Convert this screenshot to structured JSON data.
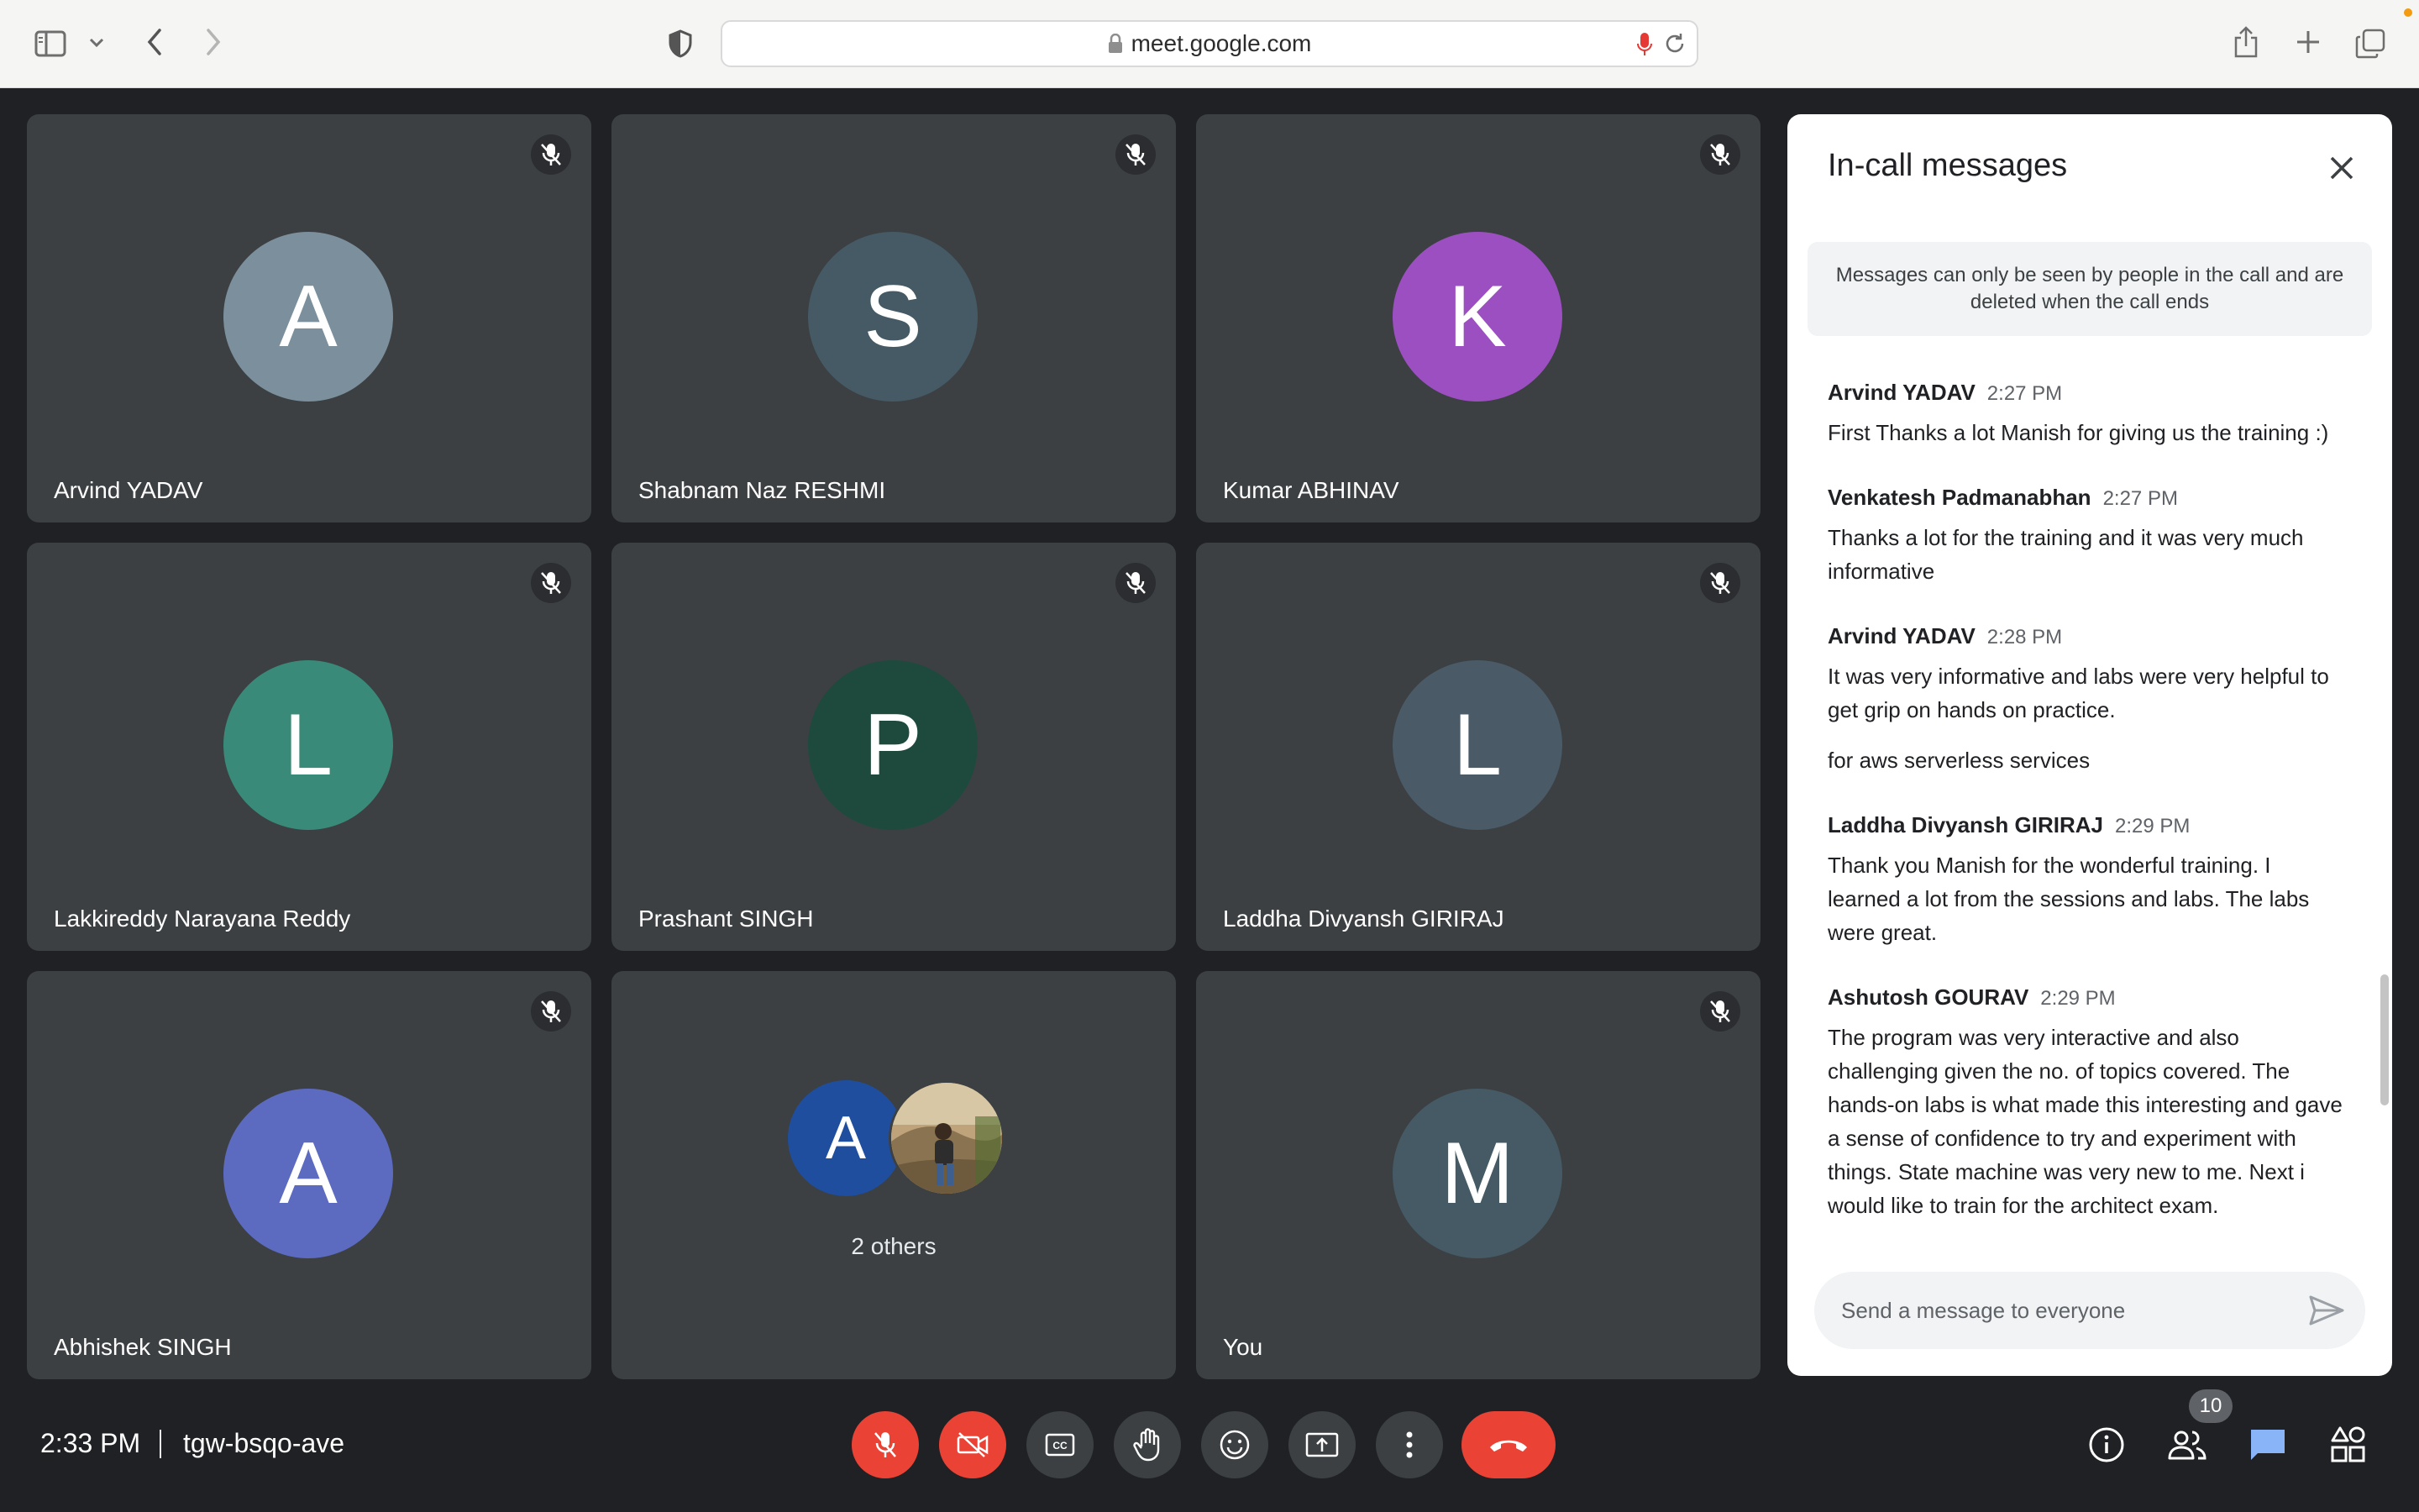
{
  "browser": {
    "url": "meet.google.com"
  },
  "tiles": [
    {
      "initial": "A",
      "name": "Arvind YADAV",
      "color": "#7b8f9c"
    },
    {
      "initial": "S",
      "name": "Shabnam Naz RESHMI",
      "color": "#455a64"
    },
    {
      "initial": "K",
      "name": "Kumar ABHINAV",
      "color": "#9c4fc0"
    },
    {
      "initial": "L",
      "name": "Lakkireddy Narayana Reddy",
      "color": "#3a8a7a"
    },
    {
      "initial": "P",
      "name": "Prashant SINGH",
      "color": "#1e4a3d"
    },
    {
      "initial": "L",
      "name": "Laddha Divyansh GIRIRAJ",
      "color": "#4a5a66"
    },
    {
      "initial": "A",
      "name": "Abhishek SINGH",
      "color": "#5c6bc0"
    },
    {
      "initial": "A",
      "label": "2 others",
      "color": "#1f4e9e"
    },
    {
      "initial": "M",
      "name": "You",
      "color": "#455a64"
    }
  ],
  "chat": {
    "title": "In-call messages",
    "notice": "Messages can only be seen by people in the call and are deleted when the call ends",
    "messages": [
      {
        "sender": "Arvind YADAV",
        "time": "2:27 PM",
        "text": "First Thanks a lot Manish for giving us the training :)"
      },
      {
        "sender": "Venkatesh Padmanabhan",
        "time": "2:27 PM",
        "text": "Thanks a lot for the training and it was very much informative"
      },
      {
        "sender": "Arvind YADAV",
        "time": "2:28 PM",
        "text": "It was very informative and labs were very helpful to get grip on hands on practice.",
        "extra": "for aws serverless services"
      },
      {
        "sender": "Laddha Divyansh GIRIRAJ",
        "time": "2:29 PM",
        "text": "Thank you Manish for the wonderful training. I learned a lot from the sessions and labs. The labs were great."
      },
      {
        "sender": "Ashutosh GOURAV",
        "time": "2:29 PM",
        "text": "The program was very interactive and also challenging given the no. of topics covered. The hands-on labs is what made this interesting and gave a sense of confidence to try and experiment with things. State machine was very new to me. Next i would like to train for the architect exam."
      }
    ],
    "input_placeholder": "Send a message to everyone"
  },
  "bottombar": {
    "time": "2:33 PM",
    "meeting_code": "tgw-bsqo-ave",
    "people_count": "10"
  },
  "colors": {
    "accent_blue": "#8ab4f8",
    "end_call_red": "#ea4335"
  }
}
